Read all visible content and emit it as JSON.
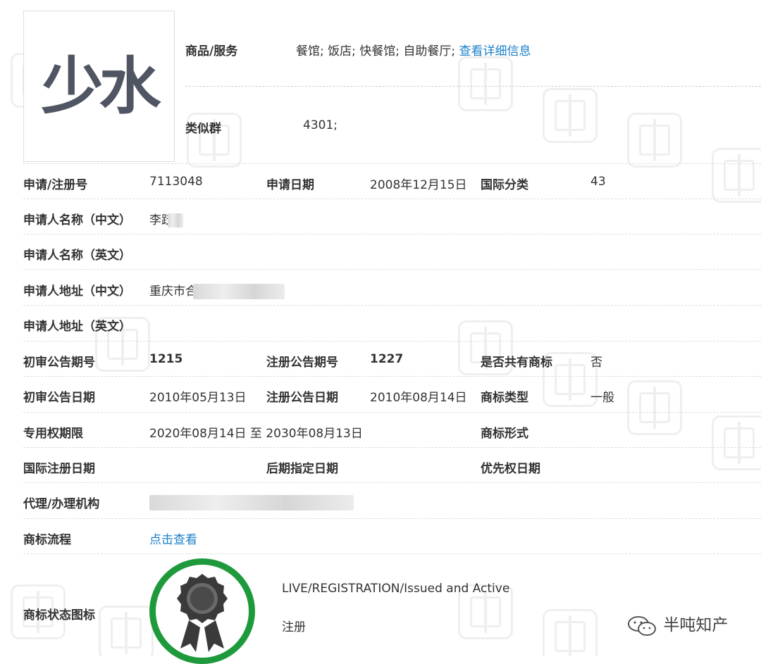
{
  "logo": {
    "text": "少水"
  },
  "goods": {
    "label": "商品/服务",
    "value": "餐馆; 饭店; 快餐馆; 自助餐厅; ",
    "link": "查看详细信息"
  },
  "similar_group": {
    "label": "类似群",
    "value": "4301;"
  },
  "row_reg": {
    "reg_no_label": "申请/注册号",
    "reg_no": "7113048",
    "apply_date_label": "申请日期",
    "apply_date": "2008年12月15日",
    "intl_class_label": "国际分类",
    "intl_class": "43"
  },
  "applicant_cn": {
    "label": "申请人名称（中文）",
    "value": "李跃"
  },
  "applicant_en": {
    "label": "申请人名称（英文）"
  },
  "address_cn": {
    "label": "申请人地址（中文）",
    "value": "重庆市合"
  },
  "address_en": {
    "label": "申请人地址（英文）"
  },
  "row_pub": {
    "prelim_no_label": "初审公告期号",
    "prelim_no": "1215",
    "reg_pub_no_label": "注册公告期号",
    "reg_pub_no": "1227",
    "shared_label": "是否共有商标",
    "shared": "否"
  },
  "row_pubdate": {
    "prelim_date_label": "初审公告日期",
    "prelim_date": "2010年05月13日",
    "reg_pub_date_label": "注册公告日期",
    "reg_pub_date": "2010年08月14日",
    "type_label": "商标类型",
    "type": "一般"
  },
  "row_term": {
    "term_label": "专用权期限",
    "term": "2020年08月14日 至 2030年08月13日",
    "form_label": "商标形式"
  },
  "row_intl": {
    "intl_date_label": "国际注册日期",
    "later_label": "后期指定日期",
    "priority_label": "优先权日期"
  },
  "agency": {
    "label": "代理/办理机构"
  },
  "flow": {
    "label": "商标流程",
    "link": "点击查看"
  },
  "status": {
    "label": "商标状态图标",
    "line1": "LIVE/REGISTRATION/Issued and Active",
    "line2": "注册"
  },
  "watermark_brand": "半吨知产",
  "colors": {
    "link": "#1a7fc9",
    "badge_green": "#1e9a3c",
    "logo_gray": "#4f5562"
  }
}
